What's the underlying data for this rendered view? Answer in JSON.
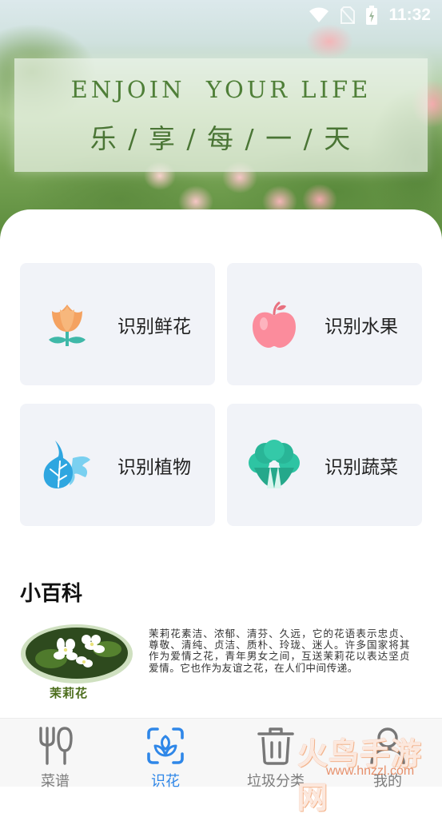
{
  "status_bar": {
    "time": "11:32"
  },
  "banner": {
    "title": "ENJOIN  YOUR LIFE",
    "subtitle": "乐 / 享 / 每 / 一 / 天"
  },
  "features": [
    {
      "label": "识别鲜花",
      "icon": "flower-icon"
    },
    {
      "label": "识别水果",
      "icon": "apple-icon"
    },
    {
      "label": "识别植物",
      "icon": "leaf-icon"
    },
    {
      "label": "识别蔬菜",
      "icon": "vegetable-icon"
    }
  ],
  "wiki": {
    "title": "小百科",
    "image_caption": "茉莉花",
    "text": "茉莉花素洁、浓郁、清芬、久远，它的花语表示忠贞、尊敬、清纯、贞洁、质朴、玲珑、迷人。许多国家将其作为爱情之花，青年男女之间，互送茉莉花以表达坚贞爱情。它也作为友谊之花，在人们中间传递。"
  },
  "nav": {
    "items": [
      {
        "label": "菜谱",
        "icon": "fork-knife-icon",
        "active": false
      },
      {
        "label": "识花",
        "icon": "scan-flower-icon",
        "active": true
      },
      {
        "label": "垃圾分类",
        "icon": "trash-icon",
        "active": false
      },
      {
        "label": "我的",
        "icon": "profile-icon",
        "active": false
      }
    ]
  },
  "watermark": {
    "brand": "火鸟手游网",
    "url": "www.hnzzl.com"
  },
  "colors": {
    "accent": "#2f87e8",
    "card_bg": "#f1f3f8",
    "banner_text": "#4f7f38"
  }
}
